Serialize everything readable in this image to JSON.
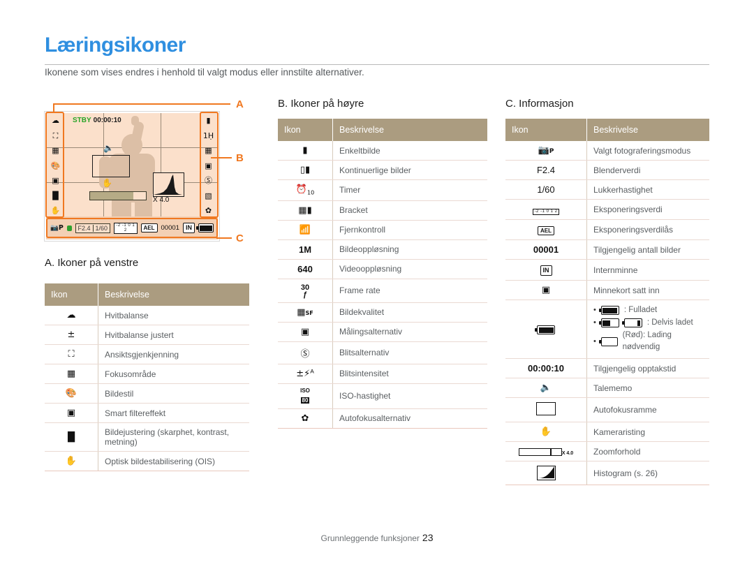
{
  "page": {
    "title": "Læringsikoner",
    "subtitle": "Ikonene som vises endres i henhold til valgt modus eller innstilte alternativer.",
    "footer_text": "Grunnleggende funksjoner",
    "footer_page": "23",
    "accent_blue": "#2f8fe0",
    "accent_orange": "#f07820",
    "table_header_bg": "#ab9c80"
  },
  "lcd": {
    "stby_label": "STBY",
    "stby_time": "00:00:10",
    "zoom_label": "X 4.0",
    "status": {
      "mode": "P",
      "aperture": "F2.4",
      "shutter": "1/60",
      "exposure_scale": "-2 -1 0 1 2",
      "ael": "AEL",
      "shots": "00001",
      "memory": "IN"
    },
    "callouts": [
      {
        "label": "A"
      },
      {
        "label": "B"
      },
      {
        "label": "C"
      }
    ]
  },
  "sections": {
    "a": {
      "heading": "A. Ikoner på venstre",
      "col_icon": "Ikon",
      "col_desc": "Beskrivelse",
      "rows": [
        {
          "icon": "white-balance-cloud-icon",
          "desc": "Hvitbalanse"
        },
        {
          "icon": "white-balance-adjust-icon",
          "desc": "Hvitbalanse justert"
        },
        {
          "icon": "face-detection-icon",
          "desc": "Ansiktsgjenkjenning"
        },
        {
          "icon": "focus-area-icon",
          "desc": "Fokusområde"
        },
        {
          "icon": "photo-style-icon",
          "desc": "Bildestil"
        },
        {
          "icon": "smart-filter-icon",
          "desc": "Smart filtereffekt"
        },
        {
          "icon": "image-adjust-icon",
          "desc": "Bildejustering (skarphet, kontrast, metning)"
        },
        {
          "icon": "ois-icon",
          "desc": "Optisk bildestabilisering (OIS)"
        }
      ]
    },
    "b": {
      "heading": "B. Ikoner på høyre",
      "col_icon": "Ikon",
      "col_desc": "Beskrivelse",
      "rows": [
        {
          "icon": "single-shot-icon",
          "desc": "Enkeltbilde"
        },
        {
          "icon": "continuous-shot-icon",
          "desc": "Kontinuerlige bilder"
        },
        {
          "icon": "timer-icon",
          "icon_text": "10",
          "desc": "Timer"
        },
        {
          "icon": "bracket-icon",
          "desc": "Bracket"
        },
        {
          "icon": "remote-control-icon",
          "desc": "Fjernkontroll"
        },
        {
          "icon": "photo-resolution-icon",
          "icon_text": "1M",
          "desc": "Bildeoppløsning"
        },
        {
          "icon": "video-resolution-icon",
          "icon_text": "640",
          "desc": "Videooppløsning"
        },
        {
          "icon": "frame-rate-icon",
          "icon_text": "30",
          "desc": "Frame rate"
        },
        {
          "icon": "image-quality-icon",
          "icon_text": "SF",
          "desc": "Bildekvalitet"
        },
        {
          "icon": "metering-icon",
          "desc": "Målingsalternativ"
        },
        {
          "icon": "flash-option-icon",
          "desc": "Blitsalternativ"
        },
        {
          "icon": "flash-intensity-icon",
          "desc": "Blitsintensitet"
        },
        {
          "icon": "iso-speed-icon",
          "icon_text": "ISO 80",
          "desc": "ISO-hastighet"
        },
        {
          "icon": "autofocus-option-icon",
          "desc": "Autofokusalternativ"
        }
      ]
    },
    "c": {
      "heading": "C. Informasjon",
      "col_icon": "Ikon",
      "col_desc": "Beskrivelse",
      "rows": [
        {
          "icon": "shooting-mode-icon",
          "icon_text": "P",
          "desc": "Valgt fotograferingsmodus"
        },
        {
          "icon": "aperture-value-text",
          "icon_text": "F2.4",
          "desc": "Blenderverdi"
        },
        {
          "icon": "shutter-speed-text",
          "icon_text": "1/60",
          "desc": "Lukkerhastighet"
        },
        {
          "icon": "exposure-value-icon",
          "icon_text": "-2 -1 0 1 2",
          "desc": "Eksponeringsverdi"
        },
        {
          "icon": "exposure-lock-icon",
          "icon_text": "AEL",
          "desc": "Eksponeringsverdilås"
        },
        {
          "icon": "available-shots-text",
          "icon_text": "00001",
          "desc": "Tilgjengelig antall bilder"
        },
        {
          "icon": "internal-memory-icon",
          "icon_text": "IN",
          "desc": "Internminne"
        },
        {
          "icon": "memory-card-icon",
          "desc": "Minnekort satt inn"
        },
        {
          "icon": "battery-icon",
          "desc": "",
          "bullets": [
            {
              "icon": "battery-full-icon",
              "text": ": Fulladet"
            },
            {
              "icon": "battery-partial-icon",
              "text": ": Delvis ladet"
            },
            {
              "icon": "battery-empty-icon",
              "text": "(Rød): Lading nødvendig"
            }
          ]
        },
        {
          "icon": "record-time-text",
          "icon_text": "00:00:10",
          "desc": "Tilgjengelig opptakstid"
        },
        {
          "icon": "voice-memo-icon",
          "desc": "Talememo"
        },
        {
          "icon": "autofocus-frame-icon",
          "desc": "Autofokusramme"
        },
        {
          "icon": "camera-shake-icon",
          "desc": "Kameraristing"
        },
        {
          "icon": "zoom-ratio-icon",
          "icon_text": "X 4.0",
          "desc": "Zoomforhold"
        },
        {
          "icon": "histogram-icon",
          "desc": "Histogram (s. 26)"
        }
      ]
    }
  }
}
